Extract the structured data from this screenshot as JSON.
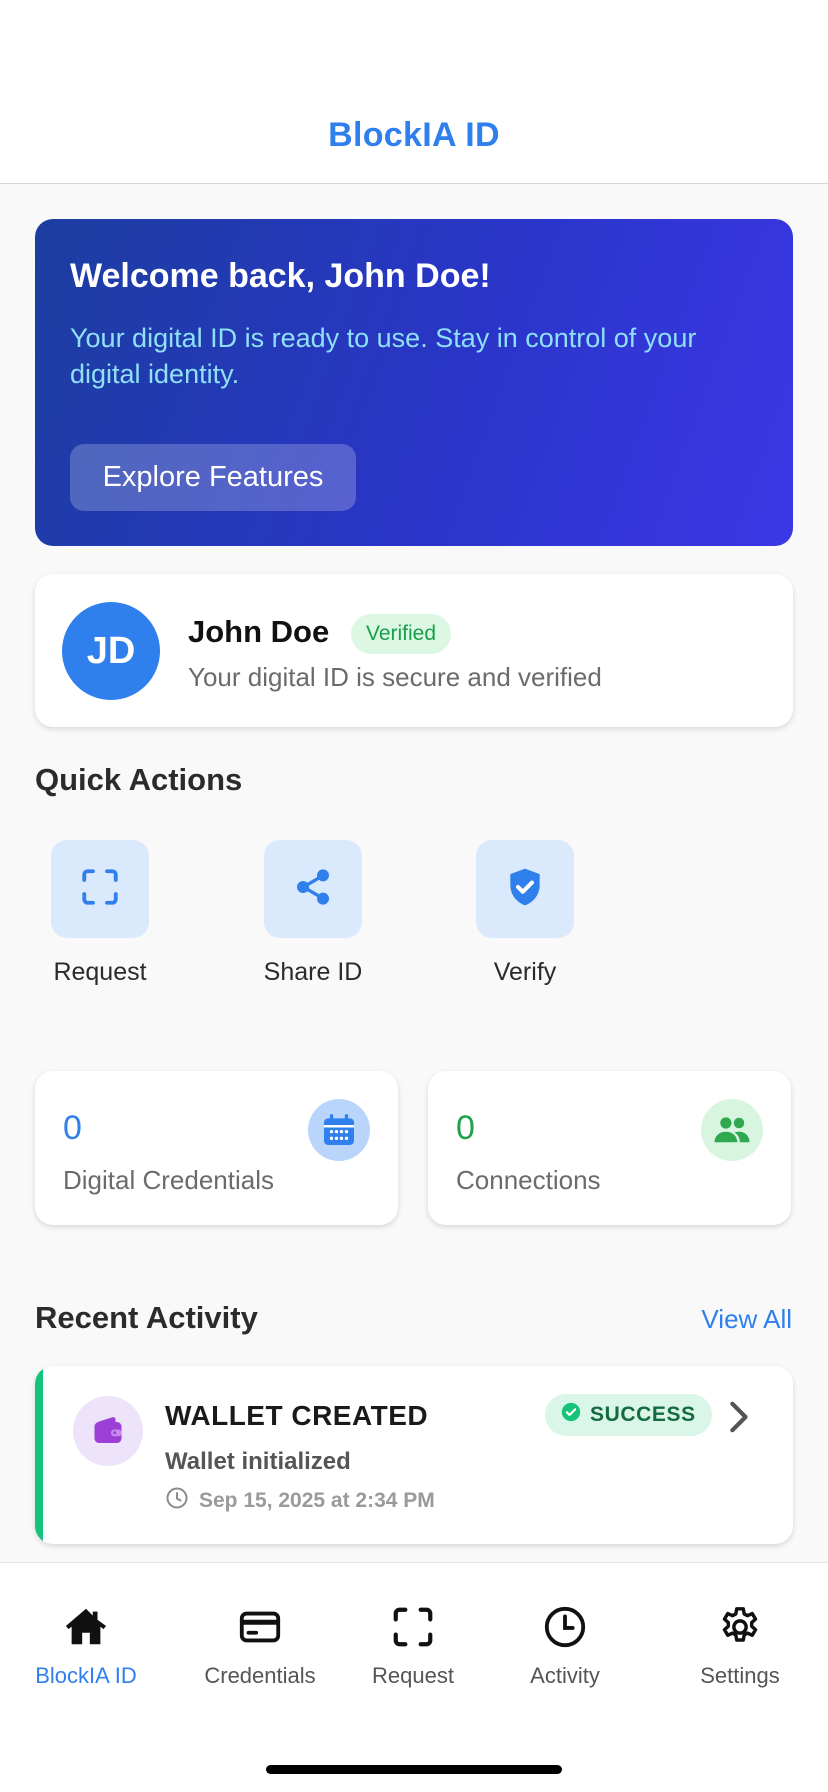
{
  "header": {
    "title": "BlockIA ID"
  },
  "banner": {
    "title": "Welcome back, John Doe!",
    "subtitle": "Your digital ID is ready to use. Stay in control of your digital identity.",
    "button_label": "Explore Features"
  },
  "profile": {
    "initials": "JD",
    "name": "John Doe",
    "badge": "Verified",
    "subtitle": "Your digital ID is secure and verified"
  },
  "quick_actions": {
    "title": "Quick Actions",
    "items": [
      {
        "label": "Request",
        "icon": "scan-icon"
      },
      {
        "label": "Share ID",
        "icon": "share-icon"
      },
      {
        "label": "Verify",
        "icon": "shield-check-icon"
      }
    ]
  },
  "stats": [
    {
      "value": "0",
      "label": "Digital Credentials",
      "icon": "calendar-icon",
      "color": "#2f80ed"
    },
    {
      "value": "0",
      "label": "Connections",
      "icon": "people-icon",
      "color": "#1fa24a"
    }
  ],
  "recent_activity": {
    "title": "Recent Activity",
    "view_all": "View All",
    "items": [
      {
        "title": "WALLET CREATED",
        "description": "Wallet initialized",
        "time": "Sep 15, 2025 at 2:34 PM",
        "status": "SUCCESS",
        "icon": "wallet-icon"
      }
    ]
  },
  "tabs": [
    {
      "label": "BlockIA ID",
      "icon": "home-icon",
      "active": true
    },
    {
      "label": "Credentials",
      "icon": "card-icon",
      "active": false
    },
    {
      "label": "Request",
      "icon": "scan-icon",
      "active": false
    },
    {
      "label": "Activity",
      "icon": "clock-icon",
      "active": false
    },
    {
      "label": "Settings",
      "icon": "gear-icon",
      "active": false
    }
  ],
  "colors": {
    "accent": "#2f80ed",
    "success": "#16c37a",
    "banner_start": "#1c3ea0",
    "banner_end": "#3b37e6"
  }
}
